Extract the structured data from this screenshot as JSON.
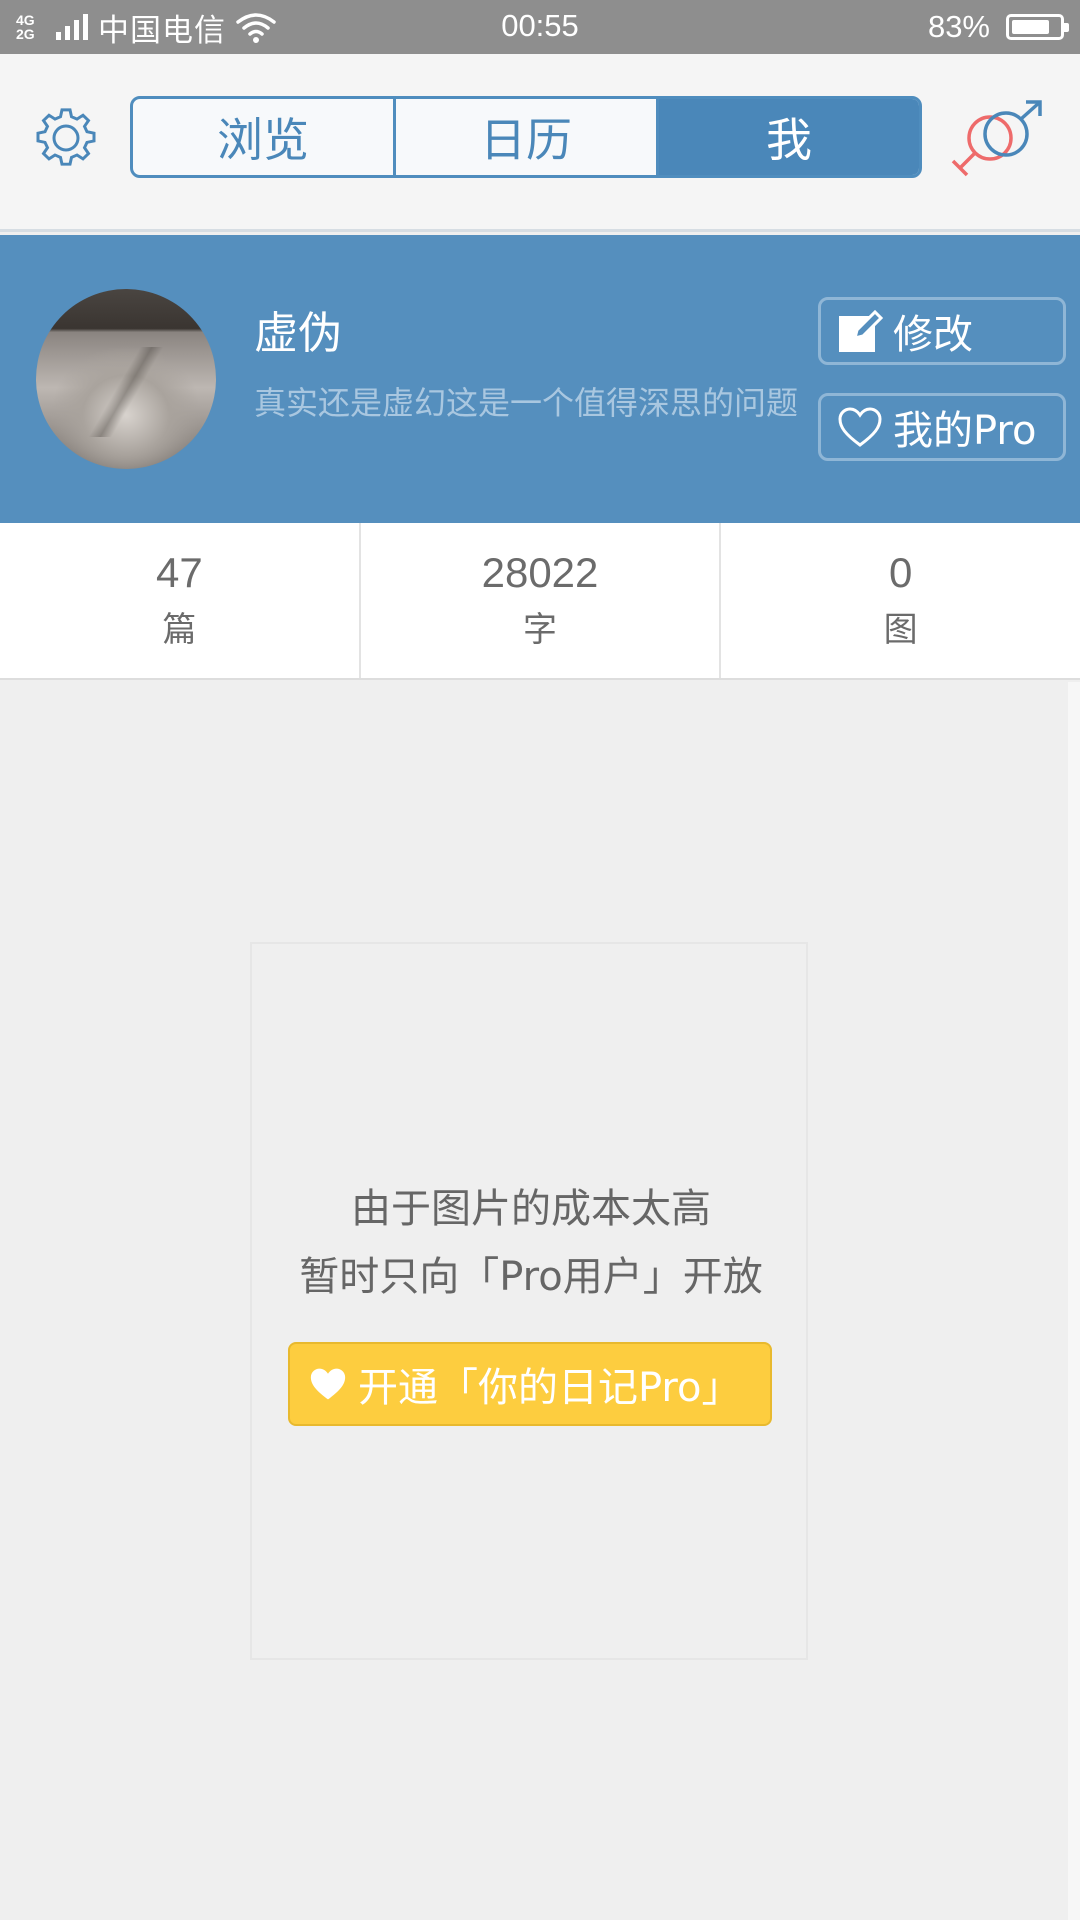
{
  "status_bar": {
    "network": "4G⁺\n2G",
    "carrier": "中国电信",
    "time": "00:55",
    "battery_percent": "83%",
    "battery_level": 0.83
  },
  "header": {
    "tabs": [
      {
        "label": "浏览",
        "active": false
      },
      {
        "label": "日历",
        "active": false
      },
      {
        "label": "我",
        "active": true
      }
    ],
    "icons": {
      "settings": "gear-icon",
      "gender": "gender-symbol-icon"
    },
    "accent_color": "#4a87b9"
  },
  "profile": {
    "name": "虚伪",
    "bio": "真实还是虚幻这是一个值得深思的问题",
    "edit_label": "修改",
    "pro_label": "我的Pro",
    "banner_color": "#558fbe"
  },
  "stats": [
    {
      "value": "47",
      "unit": "篇"
    },
    {
      "value": "28022",
      "unit": "字"
    },
    {
      "value": "0",
      "unit": "图"
    }
  ],
  "locked": {
    "line1": "由于图片的成本太高",
    "line2": "暂时只向「Pro用户」开放",
    "button_label": "开通「你的日记Pro」",
    "button_color": "#fdcd3f"
  }
}
